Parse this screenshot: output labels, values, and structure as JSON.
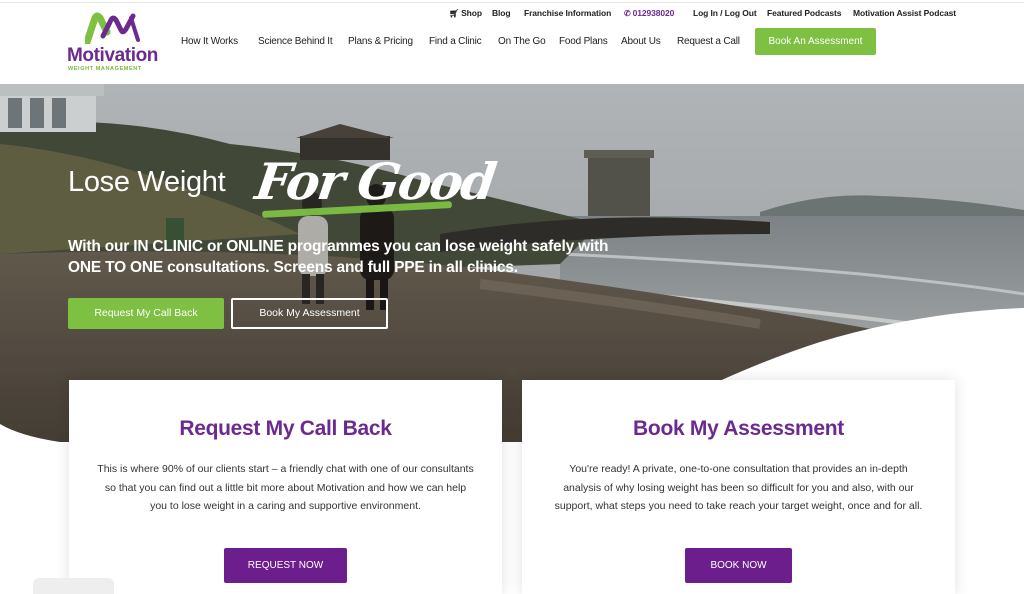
{
  "brand": {
    "name": "Motivation",
    "tagline": "WEIGHT MANAGEMENT",
    "colors": {
      "purple": "#6c2a8f",
      "green": "#7dc042",
      "button_purple": "#6c1f8c"
    }
  },
  "utility_nav": {
    "shop": {
      "icon": "cart-icon",
      "label": "Shop"
    },
    "blog": "Blog",
    "franchise": "Franchise Information",
    "phone": {
      "icon": "phone-icon",
      "label": "012938020"
    },
    "login": "Log In / Log Out",
    "podcasts": "Featured Podcasts",
    "assist_podcast": "Motivation Assist Podcast"
  },
  "main_nav": {
    "items": [
      "How It Works",
      "Science Behind It",
      "Plans & Pricing",
      "Find a Clinic",
      "On The Go",
      "Food Plans",
      "About Us",
      "Request a Call"
    ],
    "cta": "Book An Assessment"
  },
  "hero": {
    "title": "Lose Weight",
    "script": "For Good",
    "subtitle": "With our IN CLINIC or ONLINE programmes you can lose weight safely with ONE TO ONE consultations. Screens and full PPE in all clinics.",
    "primary_button": "Request My Call Back",
    "secondary_button": "Book My Assessment"
  },
  "cards": [
    {
      "title": "Request My Call Back",
      "body": "This is where 90% of our clients start – a friendly chat with one of our consultants so that you can find out a little bit more about Motivation and how we can help you to lose weight in a caring and supportive environment.",
      "button": "REQUEST NOW"
    },
    {
      "title": "Book My Assessment",
      "body": "You're ready! A private, one-to-one consultation that provides an in-depth analysis of why losing weight has been so difficult for you and also, with our support, what steps you need to take reach your target weight, once and for all.",
      "button": "BOOK NOW"
    }
  ]
}
